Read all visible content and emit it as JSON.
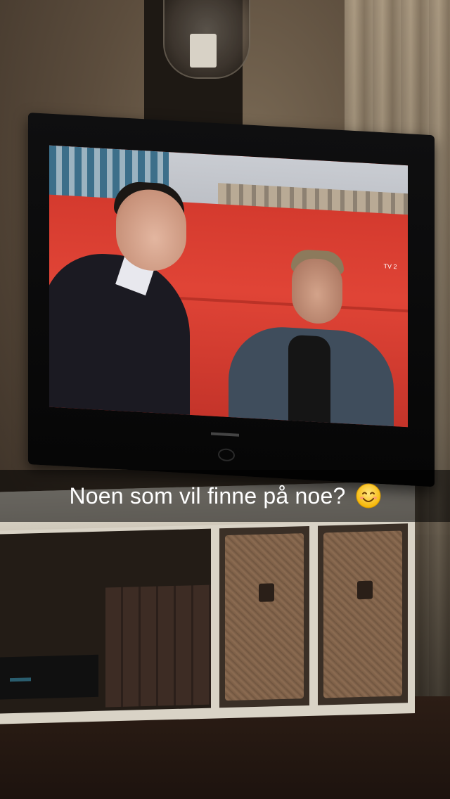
{
  "caption": {
    "text": "Noen som vil finne på noe?",
    "emoji": "smiling-face-icon"
  },
  "scene": {
    "tv_channel_logo": "TV 2"
  },
  "colors": {
    "caption_bar": "rgba(0,0,0,0.55)",
    "caption_text": "#ffffff",
    "sofa_red": "#d43a2e"
  }
}
